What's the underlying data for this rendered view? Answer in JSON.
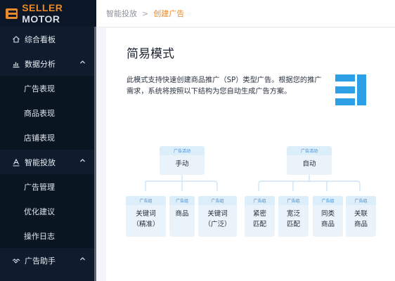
{
  "app": {
    "logo_seller": "SELLER",
    "logo_motor": "MOTOR"
  },
  "sidebar": {
    "groups": [
      {
        "label": "综合看板",
        "icon": "home-icon"
      },
      {
        "label": "数据分析",
        "icon": "chart-icon",
        "expanded": true
      },
      {
        "label": "智能投放",
        "icon": "text-a-icon",
        "expanded": true
      },
      {
        "label": "广告助手",
        "icon": "handshake-icon",
        "expanded": true
      }
    ],
    "data_items": [
      "广告表现",
      "商品表现",
      "店铺表现"
    ],
    "ads_items": [
      "广告管理",
      "优化建议",
      "操作日志"
    ]
  },
  "breadcrumb": {
    "parent": "智能投放",
    "separator": ">",
    "current": "创建广告"
  },
  "main": {
    "title": "简易模式",
    "description": "此模式支持快速创建商品推广（SP）类型广告。根据您的推广需求，系统将按照以下结构为您自动生成广告方案。"
  },
  "diagram": {
    "campaign_label": "广告活动",
    "group_label": "广告组",
    "manual": "手动",
    "auto": "自动",
    "manual_groups": [
      {
        "line1": "关键词",
        "line2": "（精准）"
      },
      {
        "line1": "商品",
        "line2": ""
      },
      {
        "line1": "关键词",
        "line2": "（广泛）"
      }
    ],
    "auto_groups": [
      {
        "line1": "紧密",
        "line2": "匹配"
      },
      {
        "line1": "宽泛",
        "line2": "匹配"
      },
      {
        "line1": "同类",
        "line2": "商品"
      },
      {
        "line1": "关联",
        "line2": "商品"
      }
    ]
  },
  "colors": {
    "accent": "#e88a2a",
    "sidebar_bg": "#0e1c2e",
    "blue": "#2c9fe6",
    "node_bg": "#ebf3fa"
  }
}
